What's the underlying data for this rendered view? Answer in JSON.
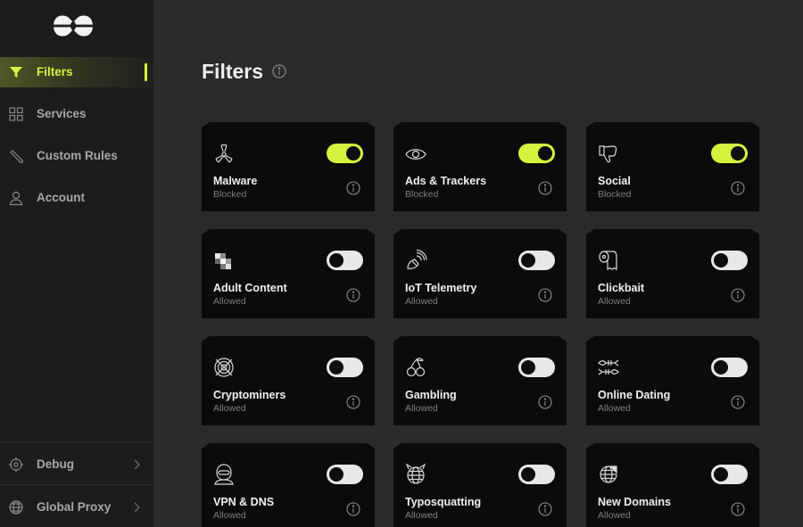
{
  "sidebar": {
    "items": [
      {
        "label": "Filters",
        "icon": "funnel-icon",
        "active": true
      },
      {
        "label": "Services",
        "icon": "grid-icon",
        "active": false
      },
      {
        "label": "Custom Rules",
        "icon": "pencil-icon",
        "active": false
      },
      {
        "label": "Account",
        "icon": "user-icon",
        "active": false
      }
    ],
    "bottom_items": [
      {
        "label": "Debug",
        "icon": "crosshair-icon"
      },
      {
        "label": "Global Proxy",
        "icon": "globe-icon"
      }
    ],
    "accent": "#d6f540"
  },
  "main": {
    "title": "Filters",
    "filters": [
      {
        "name": "Malware",
        "status": "Blocked",
        "on": true,
        "icon": "radiation-icon"
      },
      {
        "name": "Ads & Trackers",
        "status": "Blocked",
        "on": true,
        "icon": "eye-icon"
      },
      {
        "name": "Social",
        "status": "Blocked",
        "on": true,
        "icon": "thumbs-down-icon"
      },
      {
        "name": "Adult Content",
        "status": "Allowed",
        "on": false,
        "icon": "pixelated-icon"
      },
      {
        "name": "IoT Telemetry",
        "status": "Allowed",
        "on": false,
        "icon": "satellite-dish-icon"
      },
      {
        "name": "Clickbait",
        "status": "Allowed",
        "on": false,
        "icon": "toilet-paper-icon"
      },
      {
        "name": "Cryptominers",
        "status": "Allowed",
        "on": false,
        "icon": "crossed-coin-icon"
      },
      {
        "name": "Gambling",
        "status": "Allowed",
        "on": false,
        "icon": "cherries-icon"
      },
      {
        "name": "Online Dating",
        "status": "Allowed",
        "on": false,
        "icon": "fish-bones-icon"
      },
      {
        "name": "VPN & DNS",
        "status": "Allowed",
        "on": false,
        "icon": "masked-user-icon"
      },
      {
        "name": "Typosquatting",
        "status": "Allowed",
        "on": false,
        "icon": "devil-globe-icon"
      },
      {
        "name": "New Domains",
        "status": "Allowed",
        "on": false,
        "icon": "globe-sticker-icon"
      }
    ]
  },
  "colors": {
    "toggle_on": "#d4f33f",
    "card_bg": "#0b0b0b",
    "page_bg": "#2a2a2a",
    "sidebar_bg": "#1c1c1c"
  }
}
